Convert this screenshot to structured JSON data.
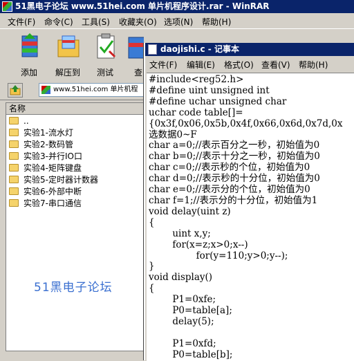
{
  "rar": {
    "title": "51黑电子论坛 www.51hei.com 单片机程序设计.rar - WinRAR",
    "menu": [
      "文件(F)",
      "命令(C)",
      "工具(S)",
      "收藏夹(O)",
      "选项(N)",
      "帮助(H)"
    ],
    "toolbar": [
      "添加",
      "解压到",
      "测试",
      "查"
    ],
    "address": "www.51hei.com 单片机程",
    "column_name": "名称",
    "files": [
      "..",
      "实验1-流水灯",
      "实验2-数码管",
      "实验3-并行IO口",
      "实验4-矩阵键盘",
      "实验5-定时器计数器",
      "实验6-外部中断",
      "实验7-串口通信"
    ],
    "watermark": "51黑电子论坛"
  },
  "notepad": {
    "title": "daojishi.c - 记事本",
    "menu": [
      "文件(F)",
      "编辑(E)",
      "格式(O)",
      "查看(V)",
      "帮助(H)"
    ],
    "code_lines": [
      "#include<reg52.h>",
      "#define uint unsigned int",
      "#define uchar unsigned char",
      "uchar code table[]=",
      "{0x3f,0x06,0x5b,0x4f,0x66,0x6d,0x7d,0x",
      "选数据0~F",
      "char a=0;//表示百分之一秒，初始值为0",
      "char b=0;//表示十分之一秒，初始值为0",
      "char c=0;//表示秒的个位，初始值为0",
      "char d=0;//表示秒的十分位，初始值为0",
      "char e=0;//表示分的个位，初始值为0",
      "char f=1;//表示分的十分位，初始值为1",
      "void delay(uint z)",
      "{",
      "        uint x,y;",
      "        for(x=z;x>0;x--)",
      "                for(y=110;y>0;y--);",
      "}",
      "void display()",
      "{",
      "        P1=0xfe;",
      "        P0=table[a];",
      "        delay(5);",
      "",
      "        P1=0xfd;",
      "        P0=table[b];"
    ]
  }
}
